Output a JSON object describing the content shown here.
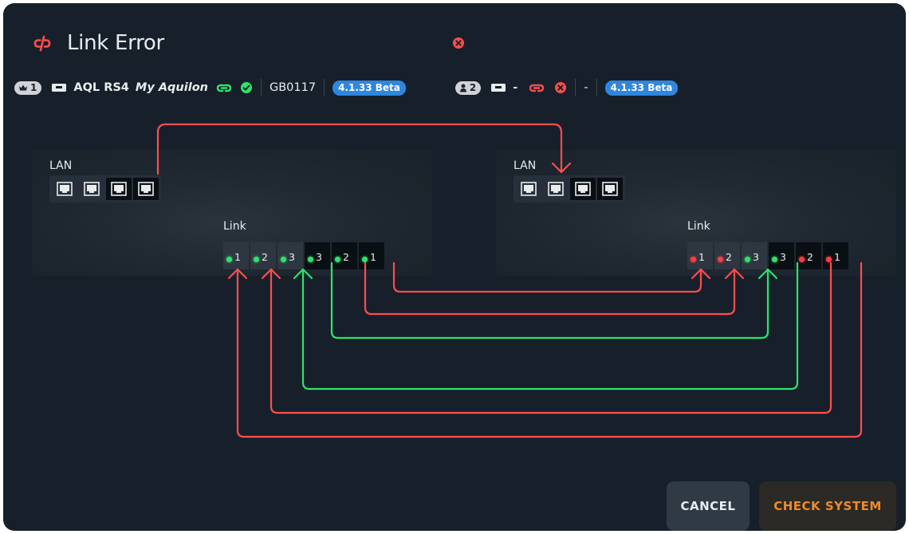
{
  "dialog": {
    "title": "Link Error",
    "title_icon": "broken-link-icon",
    "close_icon": "error-x-icon"
  },
  "systems": [
    {
      "badge_icon": "crown-icon",
      "badge_number": "1",
      "unit_icon": "device-icon",
      "model": "AQL RS4",
      "name": "My Aquilon",
      "link_status_icon": "link-icon",
      "link_status_color": "#2ee36b",
      "check_icon": "check-circle-icon",
      "serial": "GB0117",
      "version": "4.1.33 Beta"
    },
    {
      "badge_icon": "person-icon",
      "badge_number": "2",
      "unit_icon": "device-icon",
      "model": "-",
      "link_status_icon": "link-icon",
      "link_status_color": "#ff4d4d",
      "error_icon": "error-x-icon",
      "serial": "-",
      "version": "4.1.33 Beta"
    }
  ],
  "devices": [
    {
      "lan_label": "LAN",
      "link_label": "Link",
      "lan_ports": 4,
      "link_ports": [
        {
          "label": "1",
          "status": "green"
        },
        {
          "label": "2",
          "status": "green"
        },
        {
          "label": "3",
          "status": "green"
        },
        {
          "label": "3",
          "status": "green"
        },
        {
          "label": "2",
          "status": "green"
        },
        {
          "label": "1",
          "status": "green"
        }
      ]
    },
    {
      "lan_label": "LAN",
      "link_label": "Link",
      "lan_ports": 4,
      "link_ports": [
        {
          "label": "1",
          "status": "red"
        },
        {
          "label": "2",
          "status": "red"
        },
        {
          "label": "3",
          "status": "green"
        },
        {
          "label": "3",
          "status": "green"
        },
        {
          "label": "2",
          "status": "red"
        },
        {
          "label": "1",
          "status": "red"
        }
      ]
    }
  ],
  "colors": {
    "error": "#ff4d4d",
    "ok": "#2ee36b",
    "accent": "#2f86df",
    "check_button_text": "#f08a2a"
  },
  "buttons": {
    "cancel": "CANCEL",
    "check_system": "CHECK SYSTEM"
  }
}
